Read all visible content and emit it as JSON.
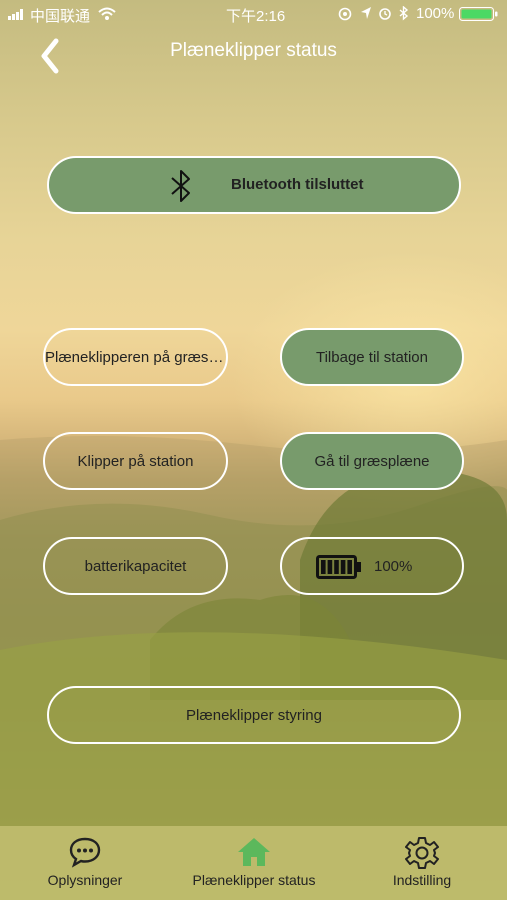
{
  "status_bar": {
    "carrier": "中国联通",
    "time": "下午2:16",
    "battery_percent": "100%"
  },
  "header": {
    "title": "Plæneklipper status"
  },
  "bluetooth": {
    "label": "Bluetooth tilsluttet",
    "icon": "bluetooth-icon"
  },
  "mower": {
    "on_lawn": "Plæneklipperen på græsplæne",
    "return_button": "Tilbage til station",
    "on_station": "Klipper på station",
    "go_lawn_button": "Gå til græsplæne",
    "battery_label": "batterikapacitet",
    "battery_value": "100%",
    "battery_level": 1.0
  },
  "control_button": "Plæneklipper styring",
  "tabs": [
    {
      "label": "Oplysninger",
      "icon": "chat-bubble-icon",
      "active": false
    },
    {
      "label": "Plæneklipper status",
      "icon": "home-icon",
      "active": true
    },
    {
      "label": "Indstilling",
      "icon": "settings-gear-icon",
      "active": false
    }
  ],
  "colors": {
    "accent_green": "#789b6c",
    "active_tab": "#5cb85c",
    "text": "#222222"
  }
}
